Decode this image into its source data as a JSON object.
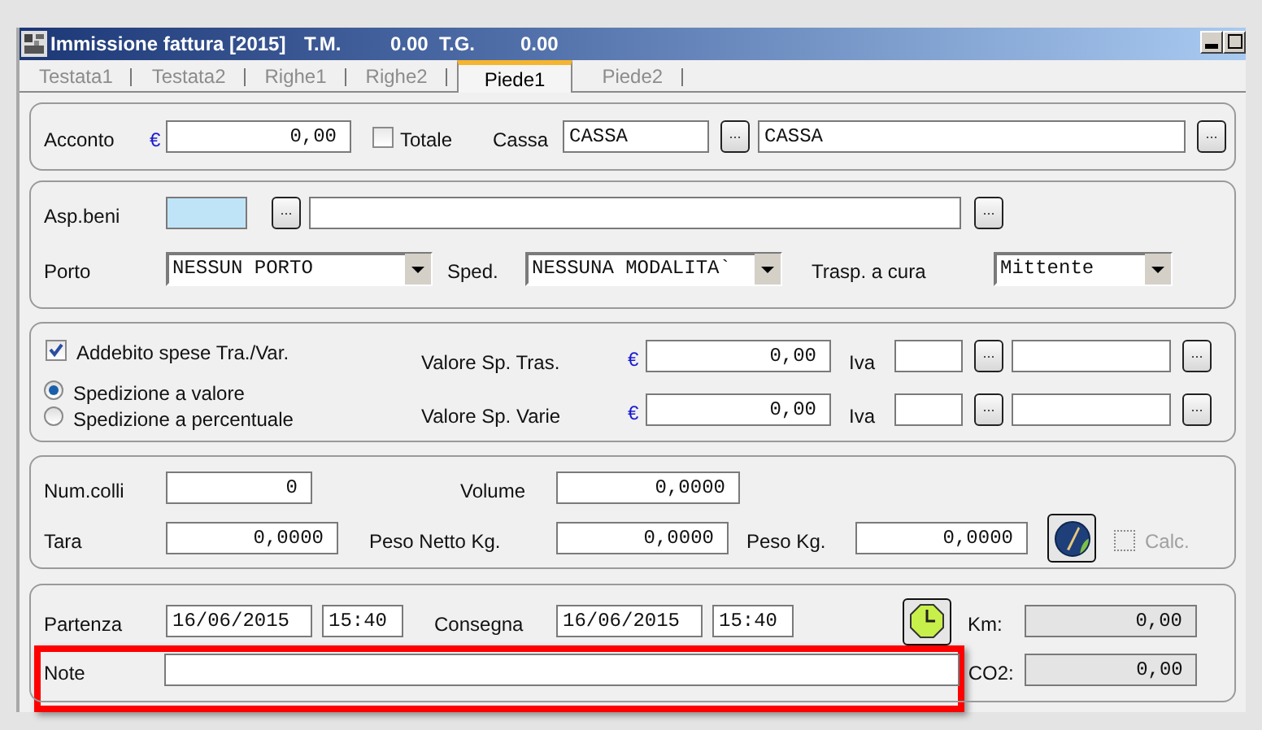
{
  "window": {
    "title": "Immissione fattura [2015]",
    "tm_label": "T.M.",
    "tm_value": "0.00",
    "tg_label": "T.G.",
    "tg_value": "0.00"
  },
  "tabs": [
    {
      "label": "Testata1",
      "selected": false
    },
    {
      "label": "Testata2",
      "selected": false
    },
    {
      "label": "Righe1",
      "selected": false
    },
    {
      "label": "Righe2",
      "selected": false
    },
    {
      "label": "Piede1",
      "selected": true
    },
    {
      "label": "Piede2",
      "selected": false
    }
  ],
  "payment": {
    "acconto_label": "Acconto",
    "currency": "€",
    "acconto_value": "0,00",
    "totale": {
      "label": "Totale",
      "checked": false
    },
    "cassa_label": "Cassa",
    "cassa_code": "CASSA",
    "cassa_button": "...",
    "cassa_description": "CASSA",
    "description_button": "..."
  },
  "goods": {
    "asp_label": "Asp.beni",
    "asp_button": "...",
    "desc_button": "...",
    "porto": {
      "label": "Porto",
      "value": "NESSUN PORTO"
    },
    "sped": {
      "label": "Sped.",
      "value": "NESSUNA MODALITA`"
    },
    "trasp": {
      "label": "Trasp. a cura",
      "value": "Mittente"
    }
  },
  "charges": {
    "addebito": {
      "label": "Addebito spese Tra./Var.",
      "checked": true
    },
    "modes": [
      {
        "label": "Spedizione a valore",
        "selected": true
      },
      {
        "label": "Spedizione a percentuale",
        "selected": false
      }
    ],
    "lines": [
      {
        "label": "Valore Sp. Tras.",
        "currency": "€",
        "value": "0,00",
        "iva_label": "Iva",
        "iva_button": "...",
        "desc_button": "..."
      },
      {
        "label": "Valore Sp. Varie",
        "currency": "€",
        "value": "0,00",
        "iva_label": "Iva",
        "iva_button": "...",
        "desc_button": "..."
      }
    ]
  },
  "packages": {
    "num_colli": {
      "label": "Num.colli",
      "value": "0"
    },
    "volume": {
      "label": "Volume",
      "value": "0,0000"
    },
    "tara": {
      "label": "Tara",
      "value": "0,0000"
    },
    "peso_netto": {
      "label": "Peso Netto Kg.",
      "value": "0,0000"
    },
    "peso": {
      "label": "Peso Kg.",
      "value": "0,0000"
    },
    "calc": {
      "label": "Calc.",
      "checked": false,
      "disabled": true
    }
  },
  "transport": {
    "partenza": {
      "label": "Partenza",
      "date": "16/06/2015",
      "time": "15:40"
    },
    "consegna": {
      "label": "Consegna",
      "date": "16/06/2015",
      "time": "15:40"
    },
    "km": {
      "label": "Km:",
      "value": "0,00"
    },
    "note": {
      "label": "Note"
    },
    "co2": {
      "label": "CO2:",
      "value": "0,00"
    }
  }
}
